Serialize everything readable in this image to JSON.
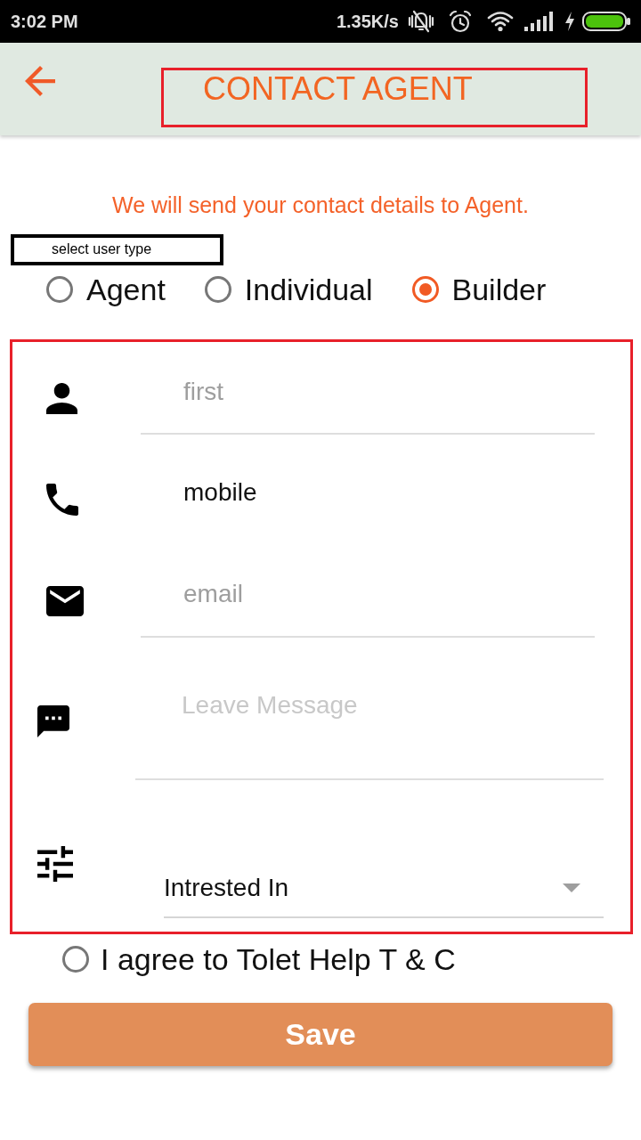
{
  "status_bar": {
    "time": "3:02 PM",
    "network_speed": "1.35K/s"
  },
  "app_bar": {
    "title": "CONTACT AGENT",
    "title_highlighted": true
  },
  "notice": "We will send your contact details to Agent.",
  "user_type": {
    "label": "select user type",
    "options": [
      {
        "label": "Agent",
        "selected": false
      },
      {
        "label": "Individual",
        "selected": false
      },
      {
        "label": "Builder",
        "selected": true
      }
    ]
  },
  "form": {
    "highlighted": true,
    "fields": [
      {
        "kind": "name",
        "placeholder": "first"
      },
      {
        "kind": "phone",
        "value": "mobile"
      },
      {
        "kind": "email",
        "placeholder": "email"
      },
      {
        "kind": "message",
        "placeholder": "Leave Message"
      },
      {
        "kind": "select",
        "value": "Intrested In"
      }
    ]
  },
  "agreement": {
    "label": "I agree to Tolet Help T & C",
    "checked": false
  },
  "save_button": "Save"
}
